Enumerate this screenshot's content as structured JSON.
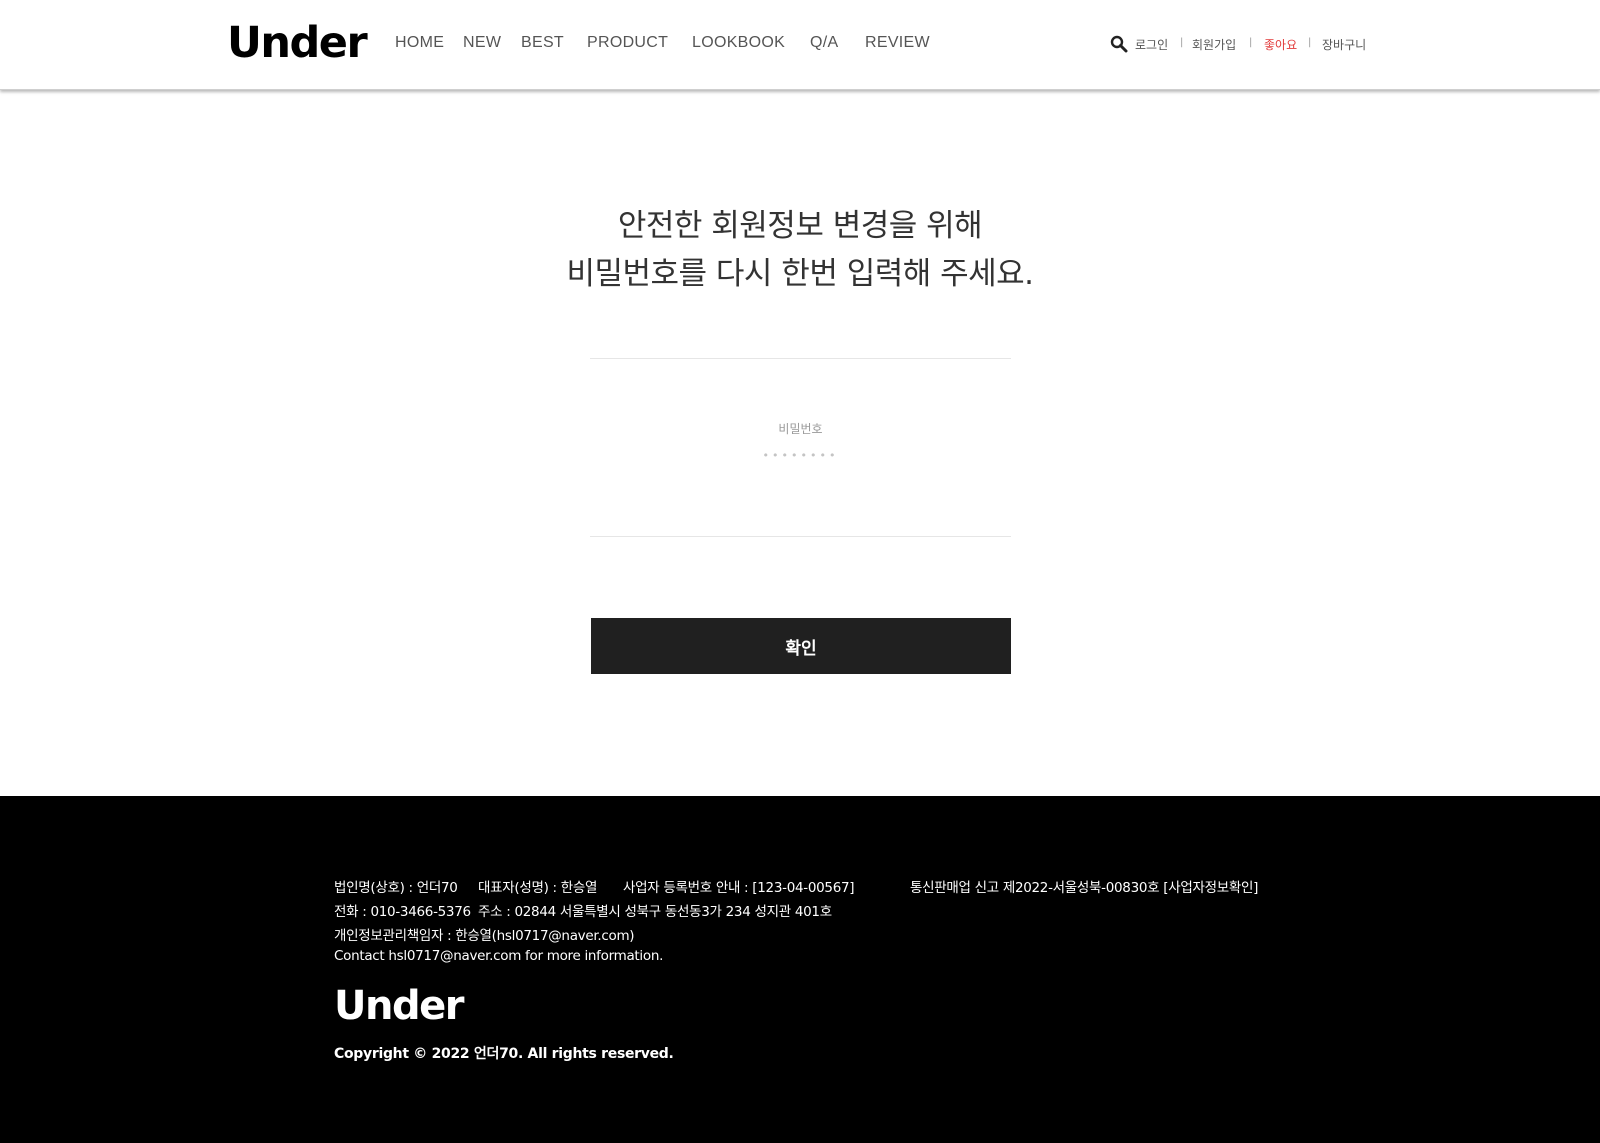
{
  "header": {
    "logo": "Under",
    "nav": [
      "HOME",
      "NEW",
      "BEST",
      "PRODUCT",
      "LOOKBOOK",
      "Q/A",
      "REVIEW"
    ],
    "util": {
      "search_icon": "search-icon",
      "login": "로그인",
      "signup": "회원가입",
      "like": "좋아요",
      "cart": "장바구니",
      "separator": "|",
      "like_color": "#e23a3a"
    }
  },
  "main": {
    "headline_line1": "안전한 회원정보 변경을 위해",
    "headline_line2": "비밀번호를 다시 한번 입력해 주세요.",
    "password_label": "비밀번호",
    "password_placeholder": "••••••••",
    "confirm_label": "확인",
    "button_color": "#202020"
  },
  "footer": {
    "company": "법인명(상호) : 언더70",
    "ceo": "대표자(성명) : 한승열",
    "business_no": "사업자 등록번호 안내 : [123-04-00567]",
    "mail_order": "통신판매업 신고 제2022-서울성북-00830호",
    "business_info_link": "[사업자정보확인]",
    "phone": "전화 : 010-3466-5376",
    "address": "주소 : 02844 서울특별시 성북구 동선동3가 234 성지관 401호",
    "privacy_officer": "개인정보관리책임자 : 한승열(hsl0717@naver.com)",
    "contact": "Contact hsl0717@naver.com for more information.",
    "logo": "Under",
    "copyright": "Copyright © 2022 언더70. All rights reserved."
  }
}
